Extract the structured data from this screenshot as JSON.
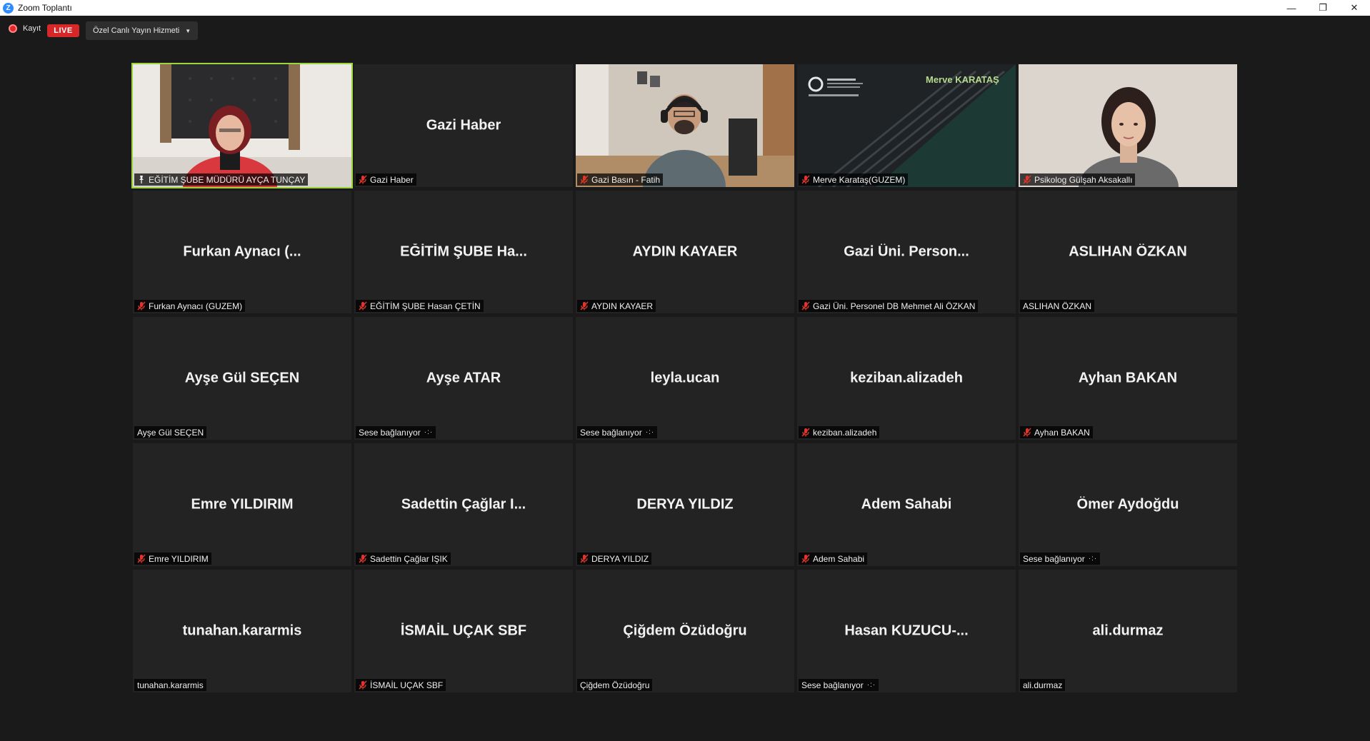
{
  "window": {
    "title": "Zoom Toplantı",
    "logo_letter": "Z",
    "minimize": "—",
    "restore": "❐",
    "close": "✕"
  },
  "toolbar": {
    "record_label": "Kayıt",
    "live_label": "LIVE",
    "stream_label": "Özel Canlı Yayın Hizmeti"
  },
  "colors": {
    "accent_active": "#9bd43b",
    "live_red": "#d62828",
    "mute_red": "#e0352b"
  },
  "tiles": [
    {
      "center": "",
      "name": "EĞİTİM ŞUBE MÜDÜRÜ AYÇA TUNÇAY",
      "muted": false,
      "video": "v1",
      "active": true,
      "connecting": false,
      "pinned": true
    },
    {
      "center": "Gazi Haber",
      "name": "Gazi Haber",
      "muted": true,
      "video": "",
      "active": false,
      "connecting": false
    },
    {
      "center": "",
      "name": "Gazi Basın - Fatih",
      "muted": true,
      "video": "v3",
      "active": false,
      "connecting": false
    },
    {
      "center": "",
      "name": "Merve Karataş(GUZEM)",
      "muted": true,
      "video": "v4",
      "active": false,
      "connecting": false
    },
    {
      "center": "",
      "name": "Psikolog Gülşah Aksakallı",
      "muted": true,
      "video": "v5",
      "active": false,
      "connecting": false
    },
    {
      "center": "Furkan Aynacı (...",
      "name": "Furkan Aynacı (GUZEM)",
      "muted": true,
      "video": "",
      "active": false,
      "connecting": false
    },
    {
      "center": "EĞİTİM ŞUBE Ha...",
      "name": "EĞİTİM ŞUBE Hasan ÇETİN",
      "muted": true,
      "video": "",
      "active": false,
      "connecting": false
    },
    {
      "center": "AYDIN KAYAER",
      "name": "AYDIN KAYAER",
      "muted": true,
      "video": "",
      "active": false,
      "connecting": false
    },
    {
      "center": "Gazi Üni. Person...",
      "name": "Gazi Üni. Personel DB Mehmet Ali ÖZKAN",
      "muted": true,
      "video": "",
      "active": false,
      "connecting": false
    },
    {
      "center": "ASLIHAN ÖZKAN",
      "name": "ASLIHAN ÖZKAN",
      "muted": false,
      "video": "",
      "active": false,
      "connecting": false
    },
    {
      "center": "Ayşe Gül SEÇEN",
      "name": "Ayşe Gül SEÇEN",
      "muted": false,
      "video": "",
      "active": false,
      "connecting": false
    },
    {
      "center": "Ayşe ATAR",
      "name": "Sese bağlanıyor",
      "muted": false,
      "video": "",
      "active": false,
      "connecting": true
    },
    {
      "center": "leyla.ucan",
      "name": "Sese bağlanıyor",
      "muted": false,
      "video": "",
      "active": false,
      "connecting": true
    },
    {
      "center": "keziban.alizadeh",
      "name": "keziban.alizadeh",
      "muted": true,
      "video": "",
      "active": false,
      "connecting": false
    },
    {
      "center": "Ayhan BAKAN",
      "name": "Ayhan BAKAN",
      "muted": true,
      "video": "",
      "active": false,
      "connecting": false
    },
    {
      "center": "Emre YILDIRIM",
      "name": "Emre YILDIRIM",
      "muted": true,
      "video": "",
      "active": false,
      "connecting": false
    },
    {
      "center": "Sadettin Çağlar I...",
      "name": "Sadettin Çağlar IŞIK",
      "muted": true,
      "video": "",
      "active": false,
      "connecting": false
    },
    {
      "center": "DERYA YILDIZ",
      "name": "DERYA YILDIZ",
      "muted": true,
      "video": "",
      "active": false,
      "connecting": false
    },
    {
      "center": "Adem Sahabi",
      "name": "Adem Sahabi",
      "muted": true,
      "video": "",
      "active": false,
      "connecting": false
    },
    {
      "center": "Ömer Aydoğdu",
      "name": "Sese bağlanıyor",
      "muted": false,
      "video": "",
      "active": false,
      "connecting": true
    },
    {
      "center": "tunahan.kararmis",
      "name": "tunahan.kararmis",
      "muted": false,
      "video": "",
      "active": false,
      "connecting": false
    },
    {
      "center": "İSMAİL UÇAK SBF",
      "name": "İSMAİL UÇAK SBF",
      "muted": true,
      "video": "",
      "active": false,
      "connecting": false
    },
    {
      "center": "Çiğdem Özüdoğru",
      "name": "Çiğdem Özüdoğru",
      "muted": false,
      "video": "",
      "active": false,
      "connecting": false
    },
    {
      "center": "Hasan KUZUCU-...",
      "name": "Sese bağlanıyor",
      "muted": false,
      "video": "",
      "active": false,
      "connecting": true
    },
    {
      "center": "ali.durmaz",
      "name": "ali.durmaz",
      "muted": false,
      "video": "",
      "active": false,
      "connecting": false
    }
  ],
  "video_overlays": {
    "merve_banner": "Merve KARATAŞ"
  }
}
